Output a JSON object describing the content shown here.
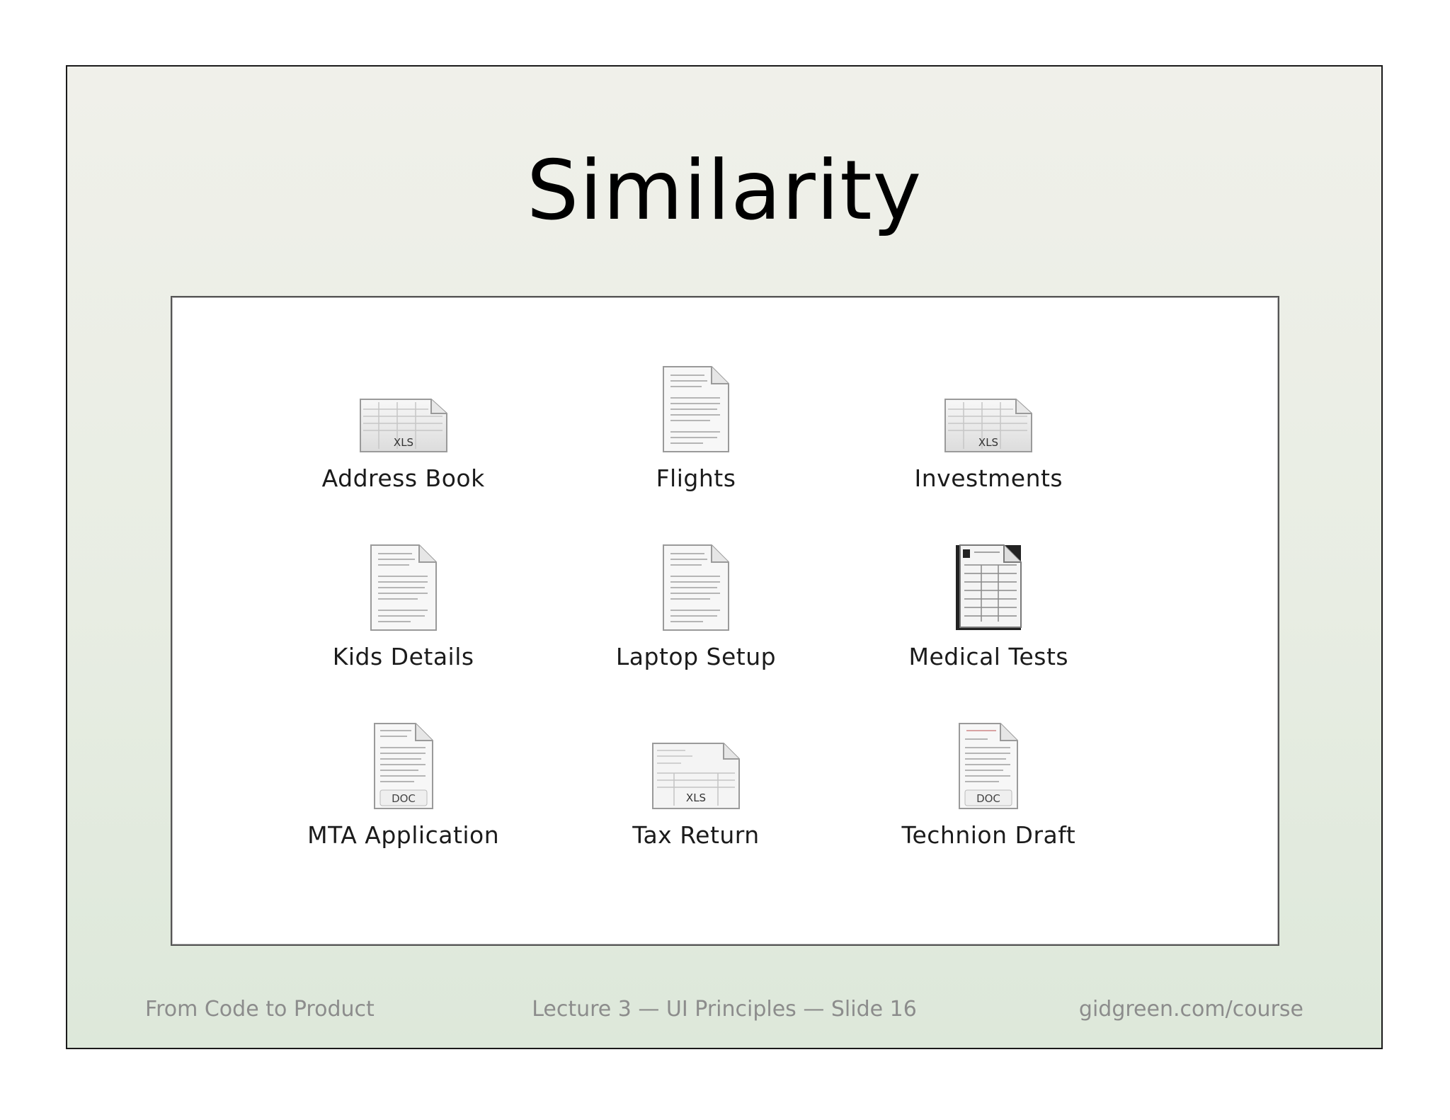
{
  "slide": {
    "title": "Similarity"
  },
  "files": [
    {
      "name": "Address Book",
      "icon": "xls-spreadsheet-icon",
      "badge": "XLS"
    },
    {
      "name": "Flights",
      "icon": "text-document-icon",
      "badge": ""
    },
    {
      "name": "Investments",
      "icon": "xls-spreadsheet-icon",
      "badge": "XLS"
    },
    {
      "name": "Kids Details",
      "icon": "text-document-icon",
      "badge": ""
    },
    {
      "name": "Laptop Setup",
      "icon": "text-document-icon",
      "badge": ""
    },
    {
      "name": "Medical Tests",
      "icon": "scanned-form-icon",
      "badge": ""
    },
    {
      "name": "MTA Application",
      "icon": "doc-document-icon",
      "badge": "DOC"
    },
    {
      "name": "Tax Return",
      "icon": "xls-form-icon",
      "badge": "XLS"
    },
    {
      "name": "Technion Draft",
      "icon": "doc-document-icon",
      "badge": "DOC"
    }
  ],
  "footer": {
    "left": "From Code to Product",
    "center": "Lecture 3 — UI Principles — Slide 16",
    "right": "gidgreen.com/course"
  }
}
